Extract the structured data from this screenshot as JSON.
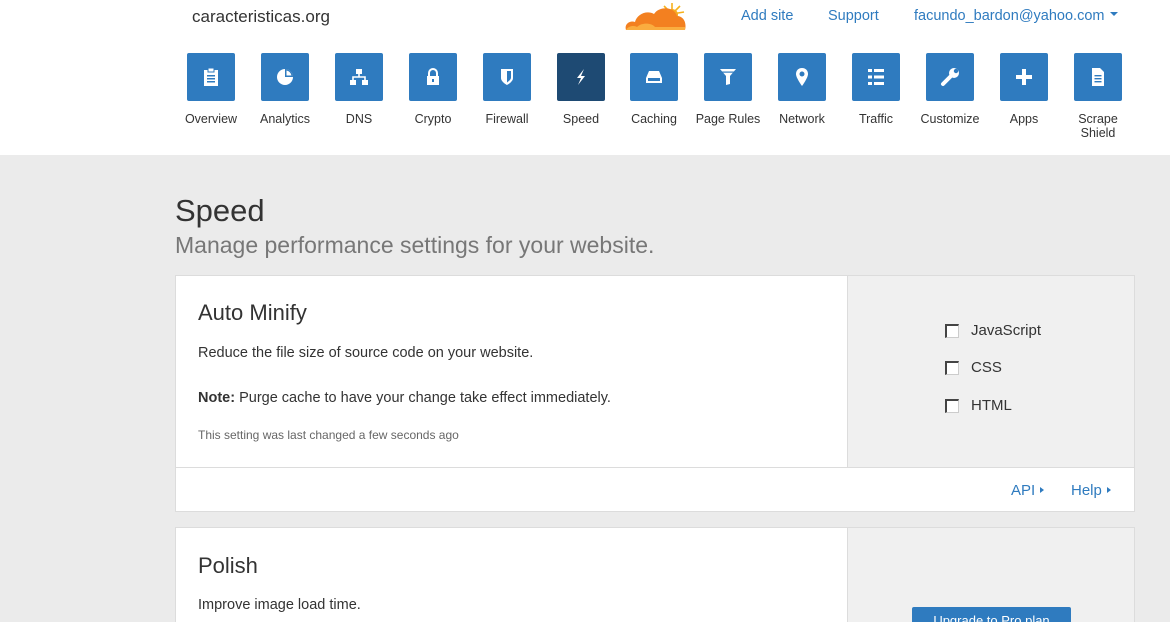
{
  "header": {
    "site_name": "caracteristicas.org",
    "logo_icon": "cloudflare-cloud-logo",
    "links": {
      "add_site": "Add site",
      "support": "Support",
      "user_email": "facundo_bardon@yahoo.com"
    }
  },
  "nav": {
    "items": [
      {
        "label": "Overview",
        "icon": "clipboard-icon"
      },
      {
        "label": "Analytics",
        "icon": "pie-chart-icon"
      },
      {
        "label": "DNS",
        "icon": "network-tree-icon"
      },
      {
        "label": "Crypto",
        "icon": "lock-icon"
      },
      {
        "label": "Firewall",
        "icon": "shield-icon"
      },
      {
        "label": "Speed",
        "icon": "lightning-icon",
        "active": true
      },
      {
        "label": "Caching",
        "icon": "hard-drive-icon"
      },
      {
        "label": "Page Rules",
        "icon": "filter-icon"
      },
      {
        "label": "Network",
        "icon": "map-pin-icon"
      },
      {
        "label": "Traffic",
        "icon": "list-icon"
      },
      {
        "label": "Customize",
        "icon": "wrench-icon"
      },
      {
        "label": "Apps",
        "icon": "plus-icon"
      },
      {
        "label": "Scrape Shield",
        "icon": "document-icon"
      }
    ]
  },
  "page": {
    "title": "Speed",
    "subtitle": "Manage performance settings for your website."
  },
  "auto_minify": {
    "title": "Auto Minify",
    "description": "Reduce the file size of source code on your website.",
    "note_label": "Note:",
    "note_text": " Purge cache to have your change take effect immediately.",
    "last_changed": "This setting was last changed a few seconds ago",
    "options": [
      {
        "label": "JavaScript",
        "checked": false
      },
      {
        "label": "CSS",
        "checked": false
      },
      {
        "label": "HTML",
        "checked": false
      }
    ],
    "footer": {
      "api": "API",
      "help": "Help"
    }
  },
  "polish": {
    "title": "Polish",
    "description": "Improve image load time.",
    "upgrade_button": "Upgrade to Pro plan"
  },
  "colors": {
    "accent": "#2f7bbf",
    "active_nav": "#1e4a73",
    "background": "#ebebeb"
  }
}
